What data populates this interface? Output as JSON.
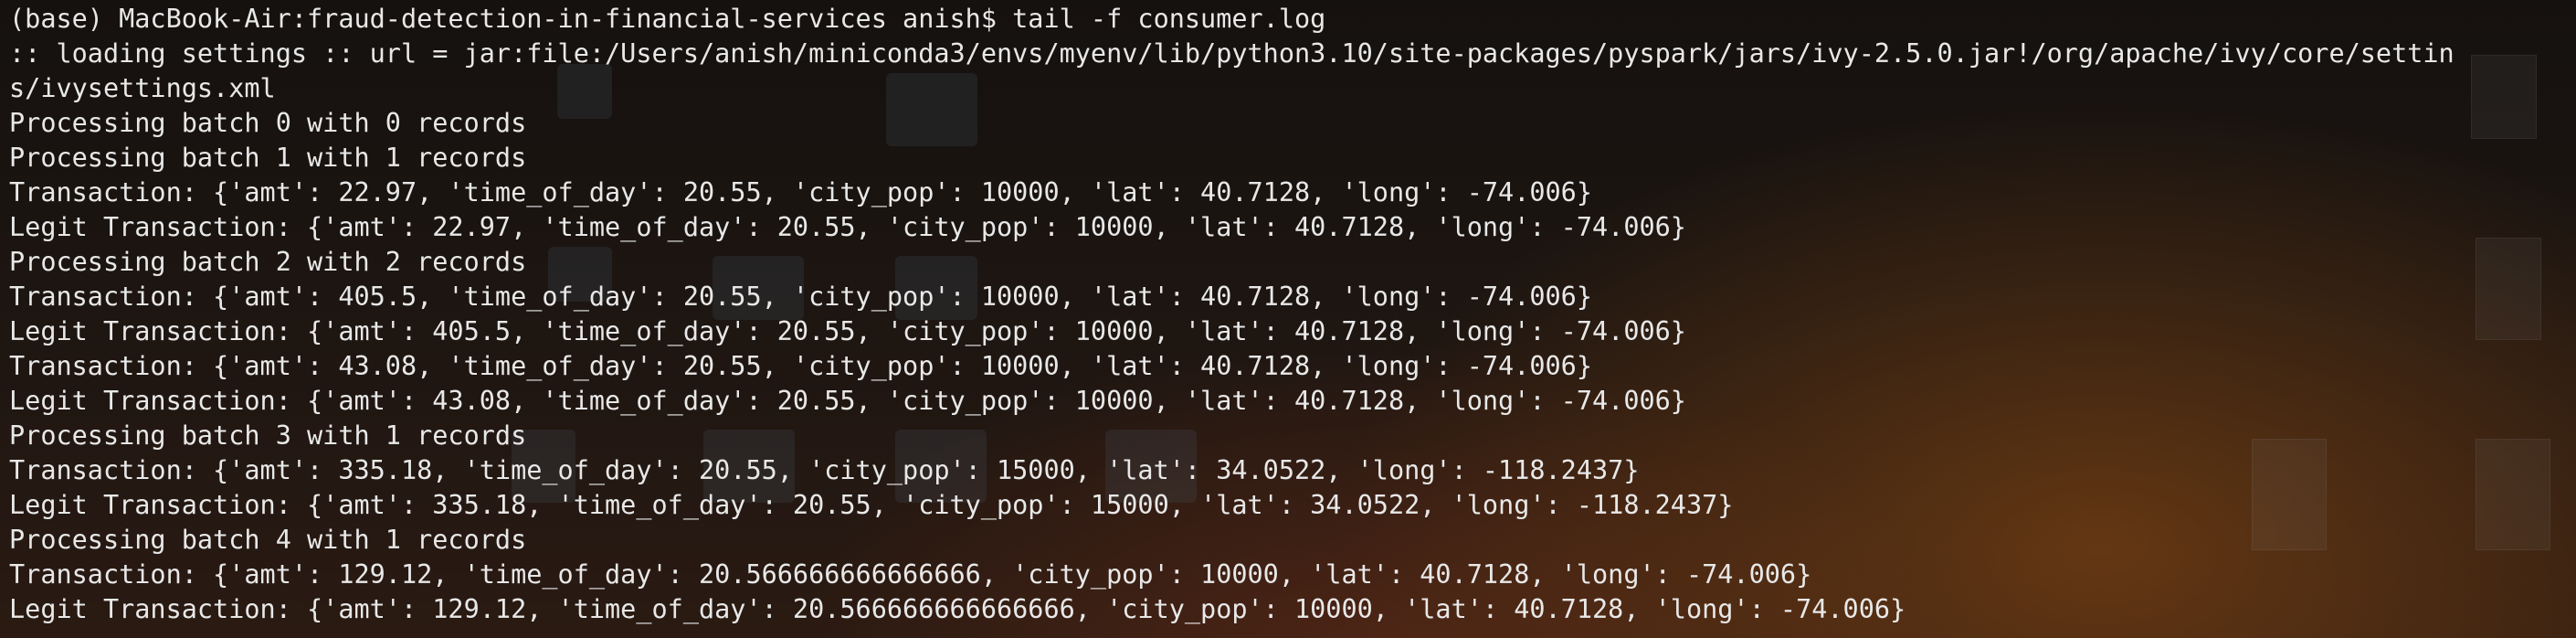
{
  "terminal": {
    "lines": [
      "(base) MacBook-Air:fraud-detection-in-financial-services anish$ tail -f consumer.log",
      ":: loading settings :: url = jar:file:/Users/anish/miniconda3/envs/myenv/lib/python3.10/site-packages/pyspark/jars/ivy-2.5.0.jar!/org/apache/ivy/core/settin",
      "s/ivysettings.xml",
      "Processing batch 0 with 0 records",
      "Processing batch 1 with 1 records",
      "Transaction: {'amt': 22.97, 'time_of_day': 20.55, 'city_pop': 10000, 'lat': 40.7128, 'long': -74.006}",
      "Legit Transaction: {'amt': 22.97, 'time_of_day': 20.55, 'city_pop': 10000, 'lat': 40.7128, 'long': -74.006}",
      "Processing batch 2 with 2 records",
      "Transaction: {'amt': 405.5, 'time_of_day': 20.55, 'city_pop': 10000, 'lat': 40.7128, 'long': -74.006}",
      "Legit Transaction: {'amt': 405.5, 'time_of_day': 20.55, 'city_pop': 10000, 'lat': 40.7128, 'long': -74.006}",
      "Transaction: {'amt': 43.08, 'time_of_day': 20.55, 'city_pop': 10000, 'lat': 40.7128, 'long': -74.006}",
      "Legit Transaction: {'amt': 43.08, 'time_of_day': 20.55, 'city_pop': 10000, 'lat': 40.7128, 'long': -74.006}",
      "Processing batch 3 with 1 records",
      "Transaction: {'amt': 335.18, 'time_of_day': 20.55, 'city_pop': 15000, 'lat': 34.0522, 'long': -118.2437}",
      "Legit Transaction: {'amt': 335.18, 'time_of_day': 20.55, 'city_pop': 15000, 'lat': 34.0522, 'long': -118.2437}",
      "Processing batch 4 with 1 records",
      "Transaction: {'amt': 129.12, 'time_of_day': 20.566666666666666, 'city_pop': 10000, 'lat': 40.7128, 'long': -74.006}",
      "Legit Transaction: {'amt': 129.12, 'time_of_day': 20.566666666666666, 'city_pop': 10000, 'lat': 40.7128, 'long': -74.006}"
    ]
  },
  "colors": {
    "text": "#e8e8e8"
  }
}
